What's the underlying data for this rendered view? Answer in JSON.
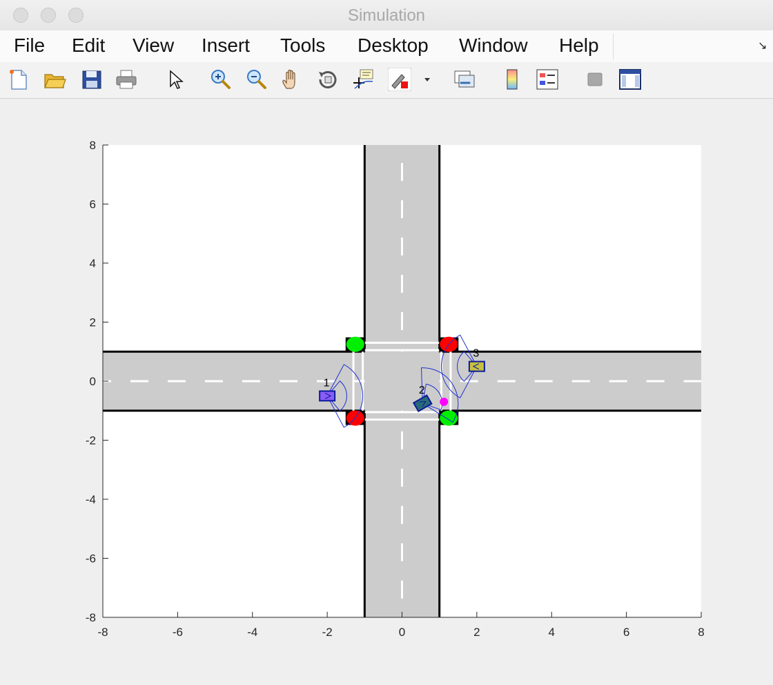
{
  "window": {
    "title": "Simulation"
  },
  "menu": {
    "items": [
      "File",
      "Edit",
      "View",
      "Insert",
      "Tools",
      "Desktop",
      "Window",
      "Help"
    ]
  },
  "toolbar": {
    "icons": [
      "new-figure-icon",
      "open-file-icon",
      "save-icon",
      "print-icon",
      "select-pointer-icon",
      "zoom-in-icon",
      "zoom-out-icon",
      "pan-hand-icon",
      "rotate-3d-icon",
      "data-cursor-icon",
      "brush-icon",
      "brush-dropdown-icon",
      "link-plot-icon",
      "colorbar-icon",
      "legend-icon",
      "hide-plot-tools-icon",
      "show-plot-tools-icon"
    ]
  },
  "plot": {
    "xlim": [
      -8,
      8
    ],
    "ylim": [
      -8,
      8
    ],
    "xticks": [
      "-8",
      "-6",
      "-4",
      "-2",
      "0",
      "2",
      "4",
      "6",
      "8"
    ],
    "yticks": [
      "8",
      "6",
      "4",
      "2",
      "0",
      "-2",
      "-4",
      "-6",
      "-8"
    ],
    "road_color": "#cccccc",
    "road_half_width": 1,
    "traffic_lights": [
      {
        "x": -1.25,
        "y": 1.25,
        "color": "#00ee00"
      },
      {
        "x": 1.25,
        "y": 1.25,
        "color": "#ff0000"
      },
      {
        "x": -1.25,
        "y": -1.25,
        "color": "#ff0000"
      },
      {
        "x": 1.25,
        "y": -1.25,
        "color": "#00ee00"
      }
    ],
    "vehicles": [
      {
        "label": "1",
        "x": -2.0,
        "y": -0.5,
        "heading_deg": 0,
        "color": "#8a5cf5"
      },
      {
        "label": "2",
        "x": 0.55,
        "y": -0.75,
        "heading_deg": 30,
        "color": "#2a6a78"
      },
      {
        "label": "3",
        "x": 2.0,
        "y": 0.5,
        "heading_deg": 180,
        "color": "#c8c040"
      }
    ],
    "target_point": {
      "x": 1.12,
      "y": -0.7,
      "color": "#ff00ff"
    }
  }
}
